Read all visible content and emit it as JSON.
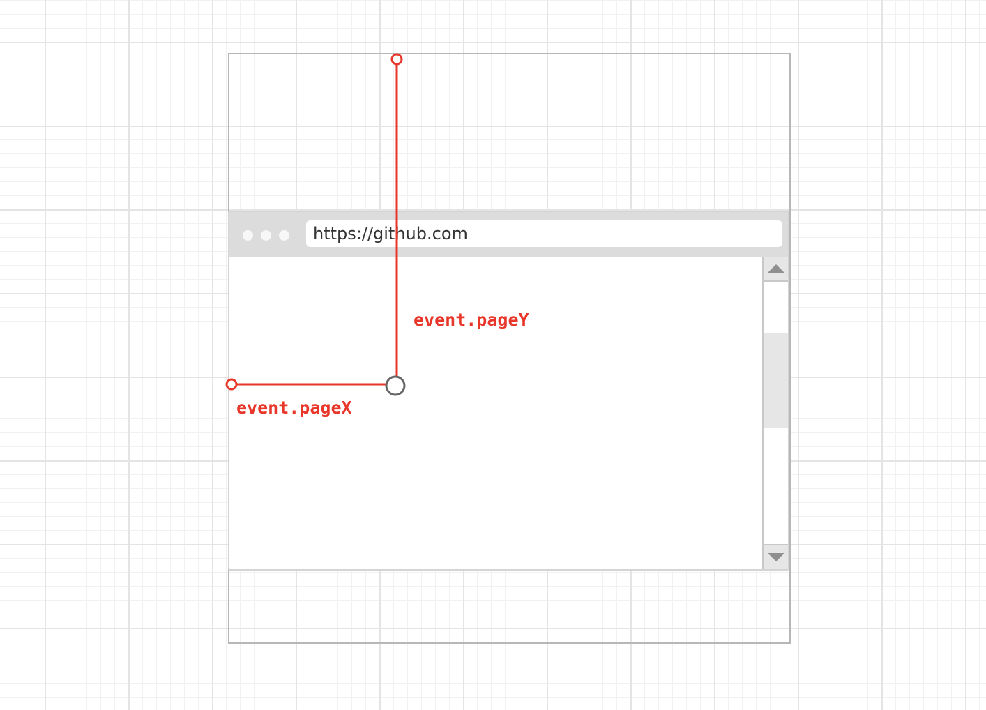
{
  "browser": {
    "address_bar": {
      "url": "https://github.com"
    },
    "window_dots": [
      "window-dot",
      "window-dot",
      "window-dot"
    ]
  },
  "annotations": {
    "page_y_label": "event.pageY",
    "page_x_label": "event.pageX"
  },
  "colors": {
    "annotation": "#e8372a",
    "cursor": "#666666",
    "frame": "#b7b7b7",
    "browser_chrome": "#dcdcdc"
  },
  "icons": {
    "scroll_up": "triangle-up-icon",
    "scroll_down": "triangle-down-icon",
    "cursor": "circle-cursor-icon"
  }
}
